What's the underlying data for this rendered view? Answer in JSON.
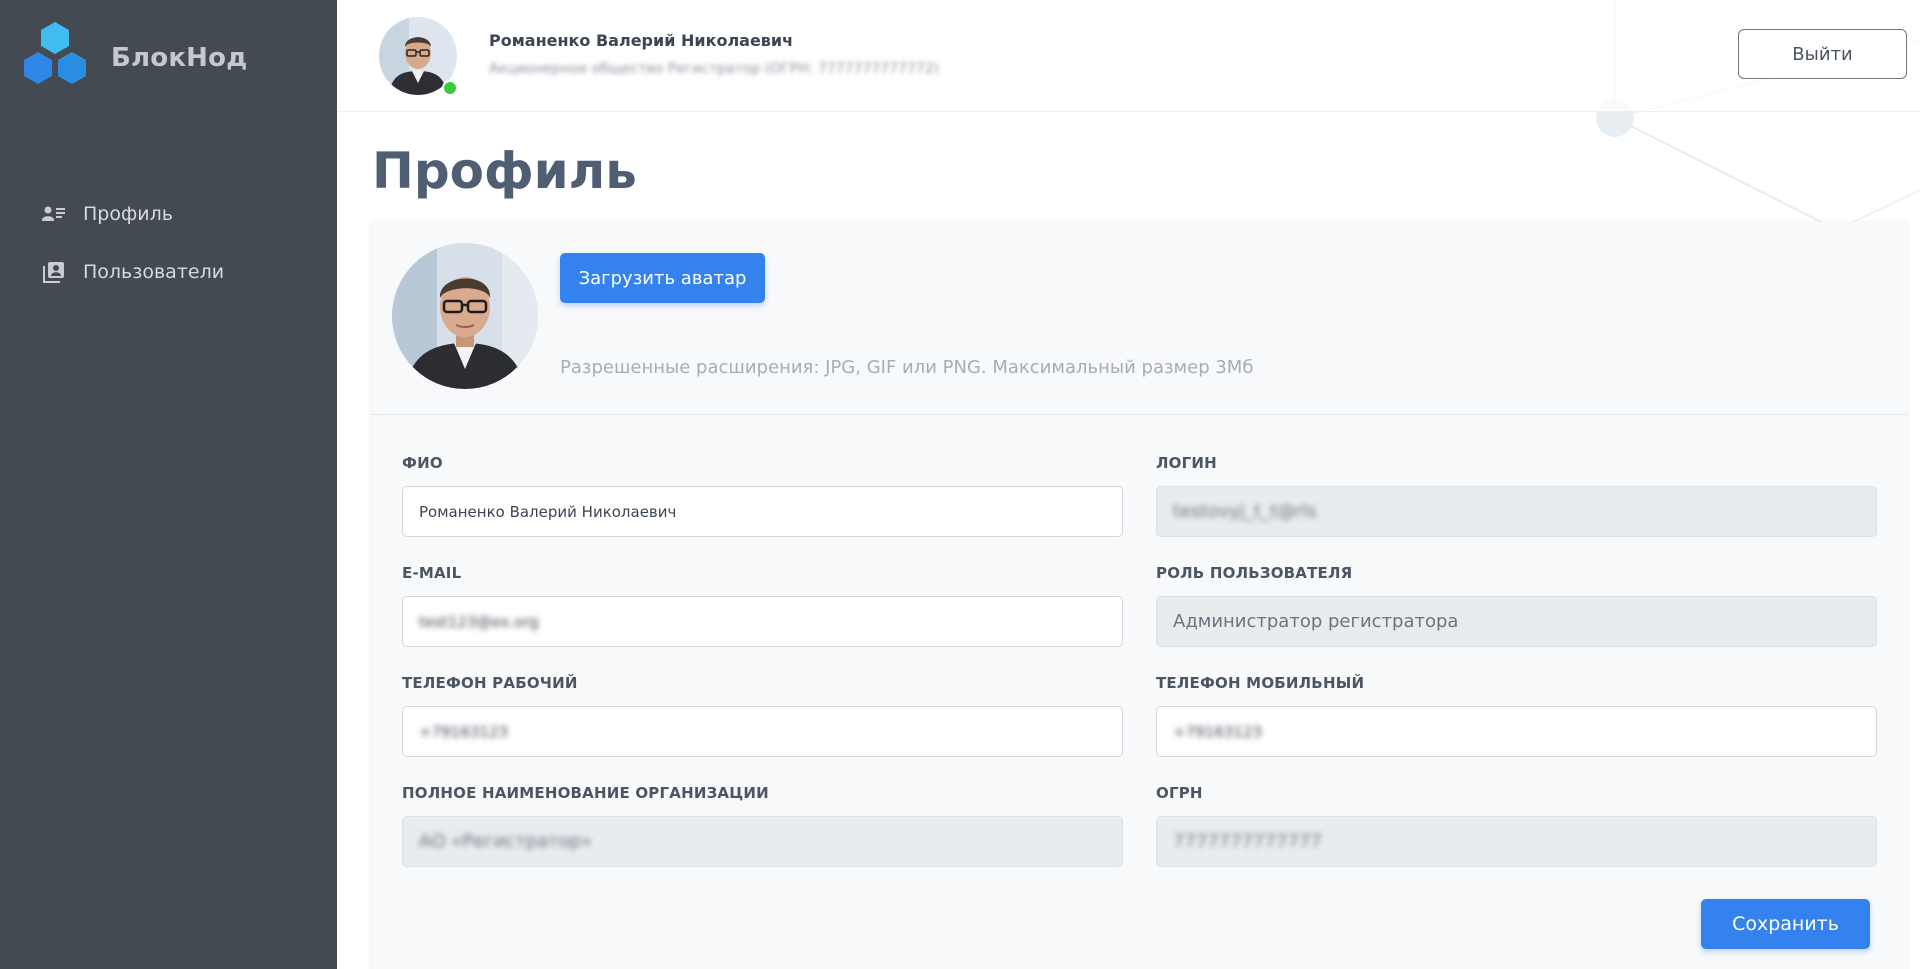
{
  "brand": {
    "name": "БлокНод"
  },
  "sidebar": {
    "items": [
      {
        "label": "Профиль",
        "icon": "profile-card-icon"
      },
      {
        "label": "Пользователи",
        "icon": "users-book-icon"
      }
    ]
  },
  "header": {
    "user_name": "Романенко Валерий Николаевич",
    "organization": "Акционерное общество Регистратор (ОГРН: 7777777777772)",
    "logout_label": "Выйти",
    "status": "online"
  },
  "page": {
    "title": "Профиль"
  },
  "avatar_section": {
    "upload_label": "Загрузить аватар",
    "hint": "Разрешенные расширения: JPG, GIF или PNG. Максимальный размер 3Мб"
  },
  "form": {
    "fio": {
      "label": "ФИО",
      "value": "Романенко Валерий Николаевич"
    },
    "login": {
      "label": "ЛОГИН",
      "value": "testovyj_t_t@rls"
    },
    "email": {
      "label": "E-MAIL",
      "value": "test123@ex.org"
    },
    "role": {
      "label": "РОЛЬ ПОЛЬЗОВАТЕЛЯ",
      "value": "Администратор регистратора"
    },
    "phone_work": {
      "label": "ТЕЛЕФОН РАБОЧИЙ",
      "value": "+7916312З"
    },
    "phone_mobile": {
      "label": "ТЕЛЕФОН МОБИЛЬНЫЙ",
      "value": "+7916312З"
    },
    "org_full_name": {
      "label": "ПОЛНОЕ НАИМЕНОВАНИЕ ОРГАНИЗАЦИИ",
      "value": "АО «Регистратор»"
    },
    "ogrn": {
      "label": "ОГРН",
      "value": "7777777777777"
    },
    "save_label": "Сохранить"
  },
  "colors": {
    "sidebar_bg": "#444a52",
    "accent": "#3382ee",
    "online": "#3ec93e",
    "title": "#4f5e72"
  }
}
